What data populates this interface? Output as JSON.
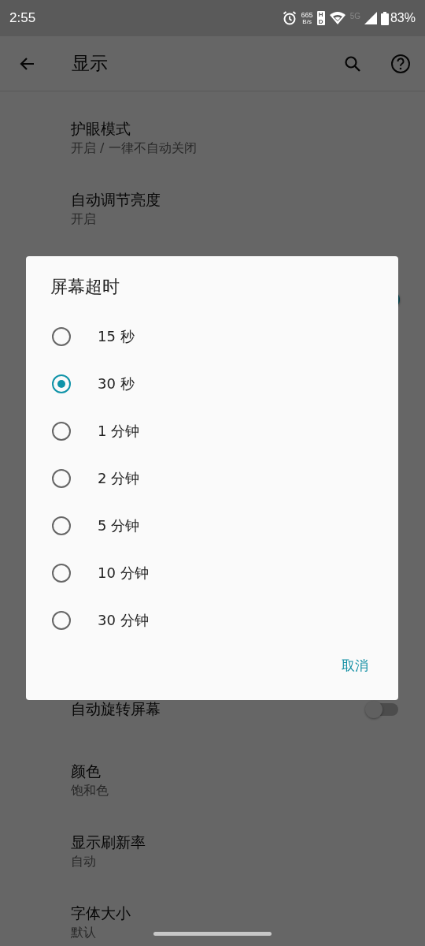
{
  "status_bar": {
    "time": "2:55",
    "net_speed": "665",
    "net_unit": "B/s",
    "hd_badge": "HD",
    "network": "5G",
    "battery": "83%"
  },
  "app_bar": {
    "title": "显示"
  },
  "settings": [
    {
      "kind": "text",
      "title": "护眼模式",
      "subtitle": "开启 / 一律不自动关闭"
    },
    {
      "kind": "text",
      "title": "自动调节亮度",
      "subtitle": "开启"
    },
    {
      "kind": "switch",
      "on": true
    },
    {
      "kind": "gap"
    },
    {
      "kind": "switch",
      "title": "自动旋转屏幕",
      "on": false
    },
    {
      "kind": "text",
      "title": "颜色",
      "subtitle": "饱和色"
    },
    {
      "kind": "text",
      "title": "显示刷新率",
      "subtitle": "自动"
    },
    {
      "kind": "text",
      "title": "字体大小",
      "subtitle": "默认"
    }
  ],
  "dialog": {
    "title": "屏幕超时",
    "options": [
      {
        "label": "15 秒",
        "selected": false
      },
      {
        "label": "30 秒",
        "selected": true
      },
      {
        "label": "1 分钟",
        "selected": false
      },
      {
        "label": "2 分钟",
        "selected": false
      },
      {
        "label": "5 分钟",
        "selected": false
      },
      {
        "label": "10 分钟",
        "selected": false
      },
      {
        "label": "30 分钟",
        "selected": false
      }
    ],
    "cancel": "取消"
  }
}
